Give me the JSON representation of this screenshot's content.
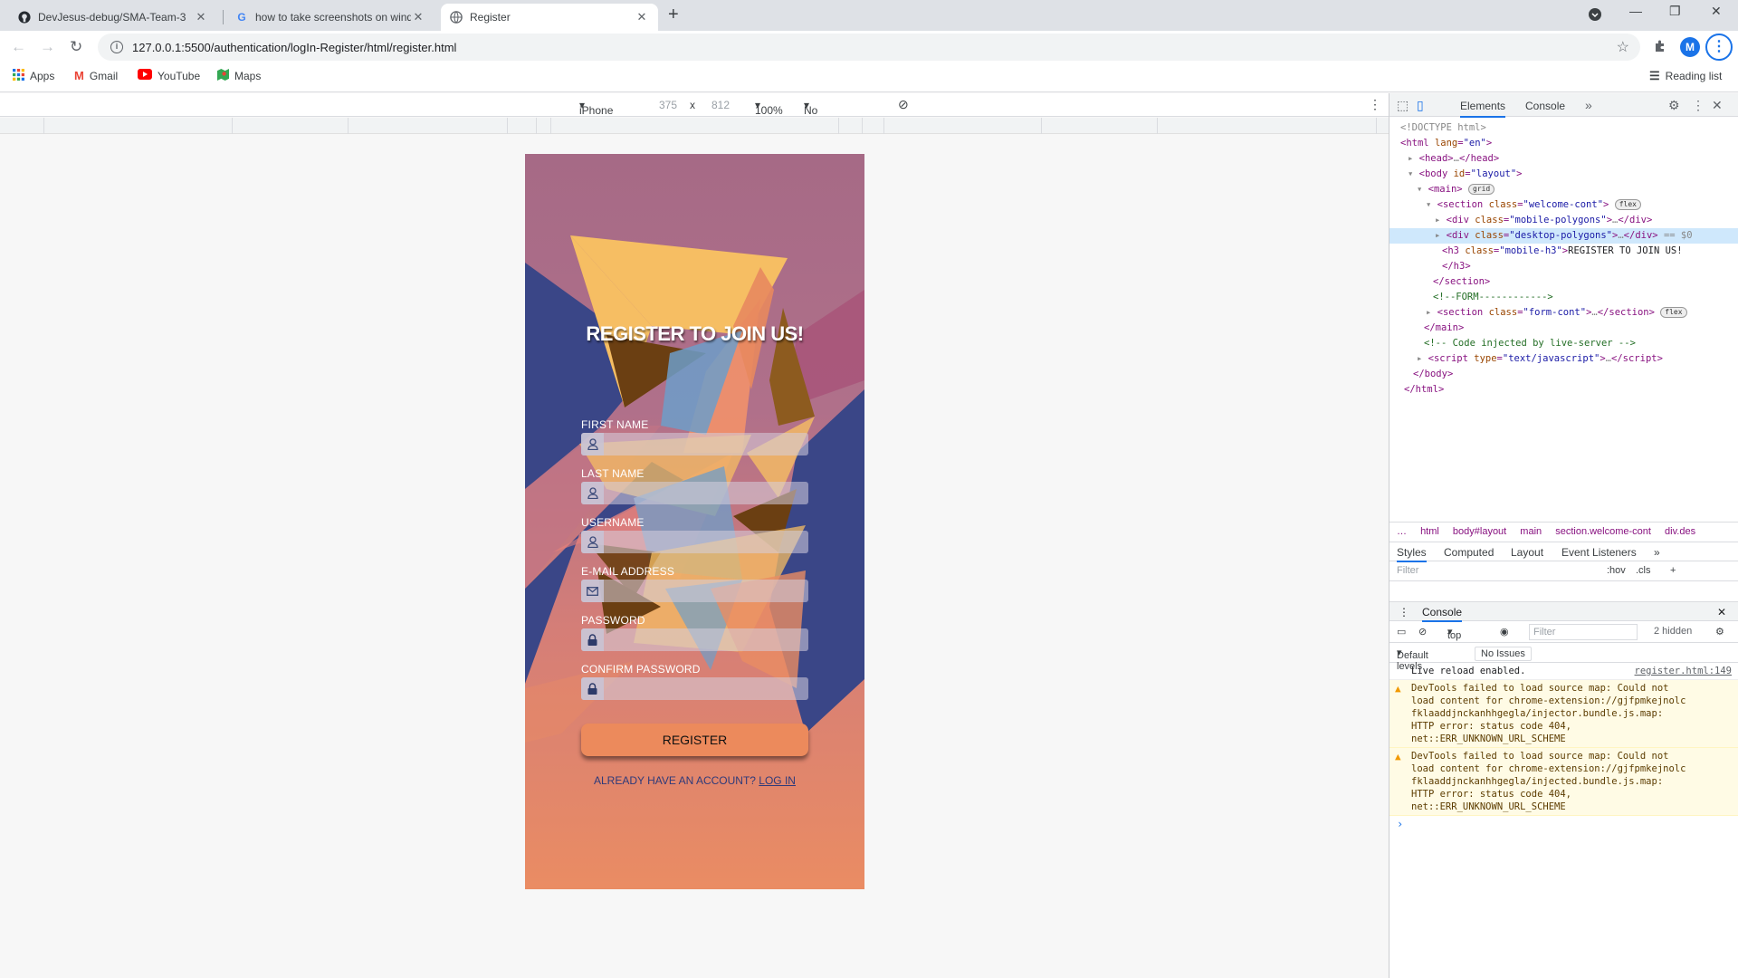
{
  "browser": {
    "tabs": [
      {
        "title": "DevJesus-debug/SMA-Team-3",
        "icon": "github-icon"
      },
      {
        "title": "how to take screenshots on wind",
        "icon": "google-icon"
      },
      {
        "title": "Register",
        "icon": "globe-icon"
      }
    ],
    "url": "127.0.0.1:5500/authentication/logIn-Register/html/register.html",
    "profile_initial": "M",
    "bookmarks": [
      "Apps",
      "Gmail",
      "YouTube",
      "Maps"
    ],
    "reading_list": "Reading list"
  },
  "device_toolbar": {
    "device": "iPhone X",
    "width": "375",
    "times": "x",
    "height": "812",
    "zoom": "100%",
    "throttling": "No throttling"
  },
  "page": {
    "heading": "REGISTER TO JOIN US!",
    "fields": [
      {
        "label": "FIRST NAME",
        "icon": "user-icon"
      },
      {
        "label": "LAST NAME",
        "icon": "user-icon"
      },
      {
        "label": "USERNAME",
        "icon": "user-icon"
      },
      {
        "label": "E-MAIL ADDRESS",
        "icon": "mail-icon"
      },
      {
        "label": "PASSWORD",
        "icon": "lock-icon"
      },
      {
        "label": "CONFIRM PASSWORD",
        "icon": "lock-icon"
      }
    ],
    "register_button": "REGISTER",
    "already_text": "ALREADY HAVE AN ACCOUNT?",
    "login_link": "LOG IN",
    "colors": {
      "navy": "#3a4687",
      "yellow": "#f6be63",
      "brown": "#6b3f12",
      "blue": "#6d9ec9",
      "salmon": "#ec8a5c"
    }
  },
  "devtools": {
    "tabs": [
      "Elements",
      "Console"
    ],
    "dom": {
      "doctype": "<!DOCTYPE html>",
      "html_open": "html",
      "lang_attr": "lang",
      "lang_val": "\"en\"",
      "head": "head",
      "body": "body",
      "body_id_attr": "id",
      "body_id_val": "\"layout\"",
      "main": "main",
      "grid_badge": "grid",
      "flex_badge": "flex",
      "section": "section",
      "class_attr": "class",
      "welcome_val": "\"welcome-cont\"",
      "div": "div",
      "mobile_poly_val": "\"mobile-polygons\"",
      "desktop_poly_val": "\"desktop-polygons\"",
      "selected_marker": "== $0",
      "h3": "h3",
      "h3_class_val": "\"mobile-h3\"",
      "h3_text": "REGISTER TO JOIN US!",
      "form_comment": "<!--FORM------------>",
      "form_cont_val": "\"form-cont\"",
      "live_comment": "<!-- Code injected by live-server -->",
      "script": "script",
      "type_attr": "type",
      "type_val": "\"text/javascript\"",
      "ellipsis": "…"
    },
    "breadcrumbs": [
      "…",
      "html",
      "body#layout",
      "main",
      "section.welcome-cont",
      "div.des"
    ],
    "style_tabs": [
      "Styles",
      "Computed",
      "Layout",
      "Event Listeners"
    ],
    "filter_placeholder": "Filter",
    "hov": ":hov",
    "cls": ".cls",
    "console": {
      "title": "Console",
      "context": "top",
      "filter_placeholder": "Filter",
      "hidden": "2 hidden",
      "levels": "Default levels",
      "issues": "No Issues",
      "messages": [
        {
          "type": "info",
          "text": "Live reload enabled.",
          "source": "register.html:149"
        },
        {
          "type": "warn",
          "lines": [
            "DevTools failed to load source map: Could not",
            "load content for chrome-extension://gjfpmkejnolc",
            "fklaaddjnckanhhgegla/injector.bundle.js.map:",
            "HTTP error: status code 404,",
            "net::ERR_UNKNOWN_URL_SCHEME"
          ]
        },
        {
          "type": "warn",
          "lines": [
            "DevTools failed to load source map: Could not",
            "load content for chrome-extension://gjfpmkejnolc",
            "fklaaddjnckanhhgegla/injected.bundle.js.map:",
            "HTTP error: status code 404,",
            "net::ERR_UNKNOWN_URL_SCHEME"
          ]
        }
      ]
    }
  }
}
